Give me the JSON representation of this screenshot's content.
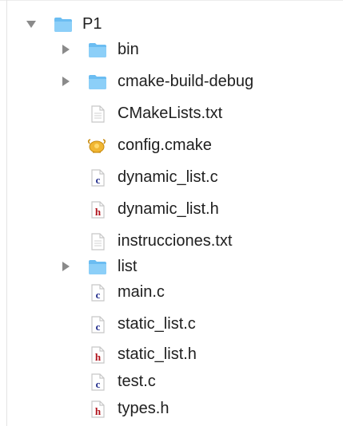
{
  "tree": {
    "root": {
      "label": "P1",
      "icon": "folder-icon",
      "expanded": true
    },
    "items": [
      {
        "label": "bin",
        "icon": "folder-icon",
        "kind": "folder",
        "expanded": false
      },
      {
        "label": "cmake-build-debug",
        "icon": "folder-icon",
        "kind": "folder",
        "expanded": false
      },
      {
        "label": "CMakeLists.txt",
        "icon": "text-file-icon",
        "kind": "text"
      },
      {
        "label": "config.cmake",
        "icon": "cmake-file-icon",
        "kind": "cmake"
      },
      {
        "label": "dynamic_list.c",
        "icon": "c-file-icon",
        "kind": "c"
      },
      {
        "label": "dynamic_list.h",
        "icon": "h-file-icon",
        "kind": "h"
      },
      {
        "label": "instrucciones.txt",
        "icon": "text-file-icon",
        "kind": "text"
      },
      {
        "label": "list",
        "icon": "folder-icon",
        "kind": "folder",
        "expanded": false
      },
      {
        "label": "main.c",
        "icon": "c-file-icon",
        "kind": "c"
      },
      {
        "label": "static_list.c",
        "icon": "c-file-icon",
        "kind": "c"
      },
      {
        "label": "static_list.h",
        "icon": "h-file-icon",
        "kind": "h"
      },
      {
        "label": "test.c",
        "icon": "c-file-icon",
        "kind": "c"
      },
      {
        "label": "types.h",
        "icon": "h-file-icon",
        "kind": "h"
      }
    ]
  },
  "colors": {
    "folder": "#6bbdf2",
    "folder_tab": "#8ccff8",
    "c_file": "#1f2a8a",
    "h_file": "#b0121b",
    "text_file": "#c7c7c7",
    "toggle": "#8a8a8a",
    "cmake": "#f1b632"
  }
}
